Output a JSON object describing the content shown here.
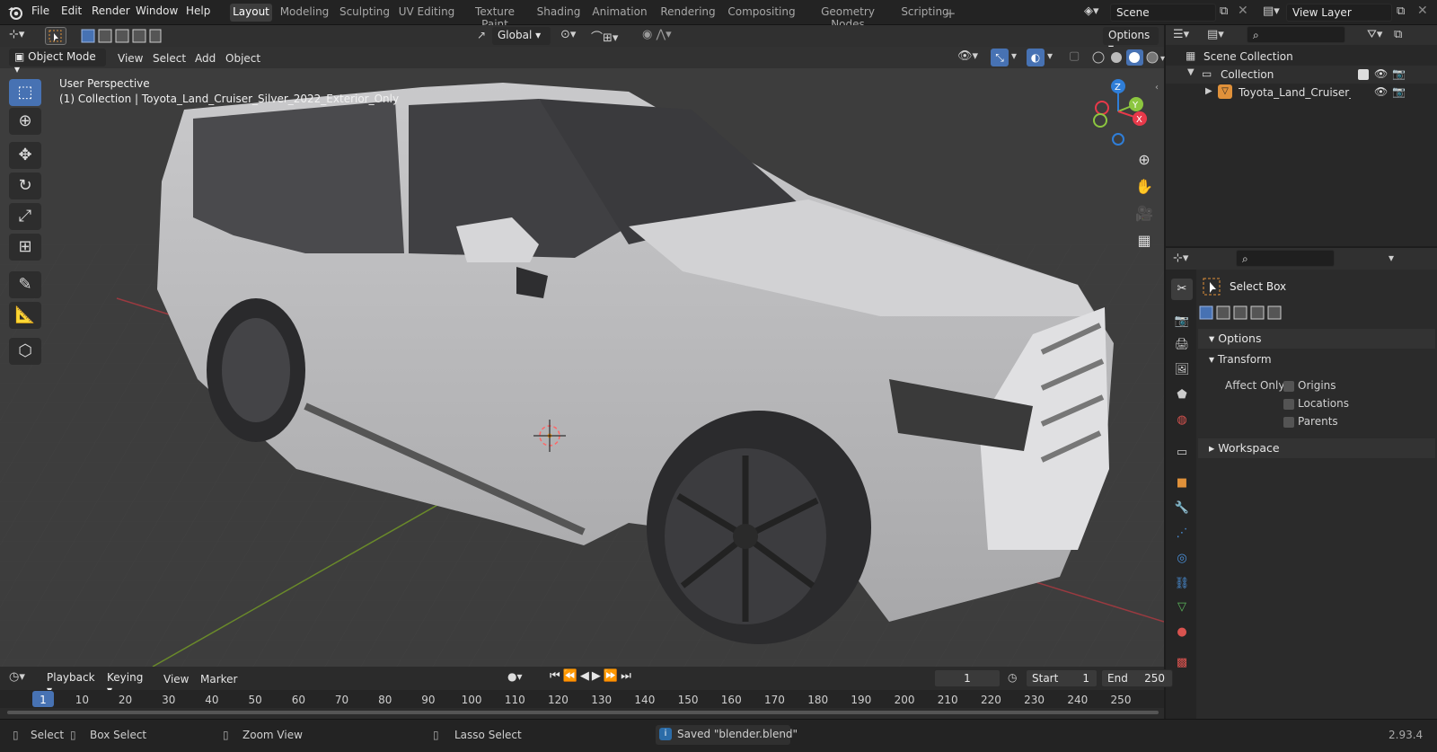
{
  "menu": {
    "logo": "blender-logo",
    "items": [
      "File",
      "Edit",
      "Render",
      "Window",
      "Help"
    ]
  },
  "workspaces": [
    "Layout",
    "Modeling",
    "Sculpting",
    "UV Editing",
    "Texture Paint",
    "Shading",
    "Animation",
    "Rendering",
    "Compositing",
    "Geometry Nodes",
    "Scripting"
  ],
  "active_workspace": "Layout",
  "scene": {
    "label": "Scene"
  },
  "view_layer": {
    "label": "View Layer"
  },
  "toolheader": {
    "orientation": "Global",
    "options": "Options"
  },
  "viewport_header": {
    "mode": "Object Mode",
    "menus": [
      "View",
      "Select",
      "Add",
      "Object"
    ]
  },
  "viewport": {
    "title": "User Perspective",
    "subtitle": "(1) Collection | Toyota_Land_Cruiser_Silver_2022_Exterior_Only",
    "gizmo": {
      "x": "X",
      "y": "Y",
      "z": "Z"
    }
  },
  "outliner": {
    "scene_collection": "Scene Collection",
    "collection": "Collection",
    "object": "Toyota_Land_Cruiser_Silv"
  },
  "properties": {
    "tool_name": "Select Box",
    "options_panel": "Options",
    "transform_panel": "Transform",
    "affect_only": "Affect Only",
    "checkboxes": [
      "Origins",
      "Locations",
      "Parents"
    ],
    "workspace_panel": "Workspace"
  },
  "timeline": {
    "menus": [
      "Playback",
      "Keying",
      "View",
      "Marker"
    ],
    "current_frame": "1",
    "start_label": "Start",
    "start": "1",
    "end_label": "End",
    "end": "250",
    "ticks": [
      "1",
      "10",
      "20",
      "30",
      "40",
      "50",
      "60",
      "70",
      "80",
      "90",
      "100",
      "110",
      "120",
      "130",
      "140",
      "150",
      "160",
      "170",
      "180",
      "190",
      "200",
      "210",
      "220",
      "230",
      "240",
      "250"
    ]
  },
  "status": {
    "select": "Select",
    "box_select": "Box Select",
    "zoom_view": "Zoom View",
    "lasso_select": "Lasso Select",
    "message": "Saved \"blender.blend\"",
    "version": "2.93.4"
  },
  "colors": {
    "accent": "#4772b3",
    "x_axis": "#e8394a",
    "y_axis": "#8cc63f",
    "z_axis": "#2f7ed8",
    "object_orange": "#e0913a"
  }
}
